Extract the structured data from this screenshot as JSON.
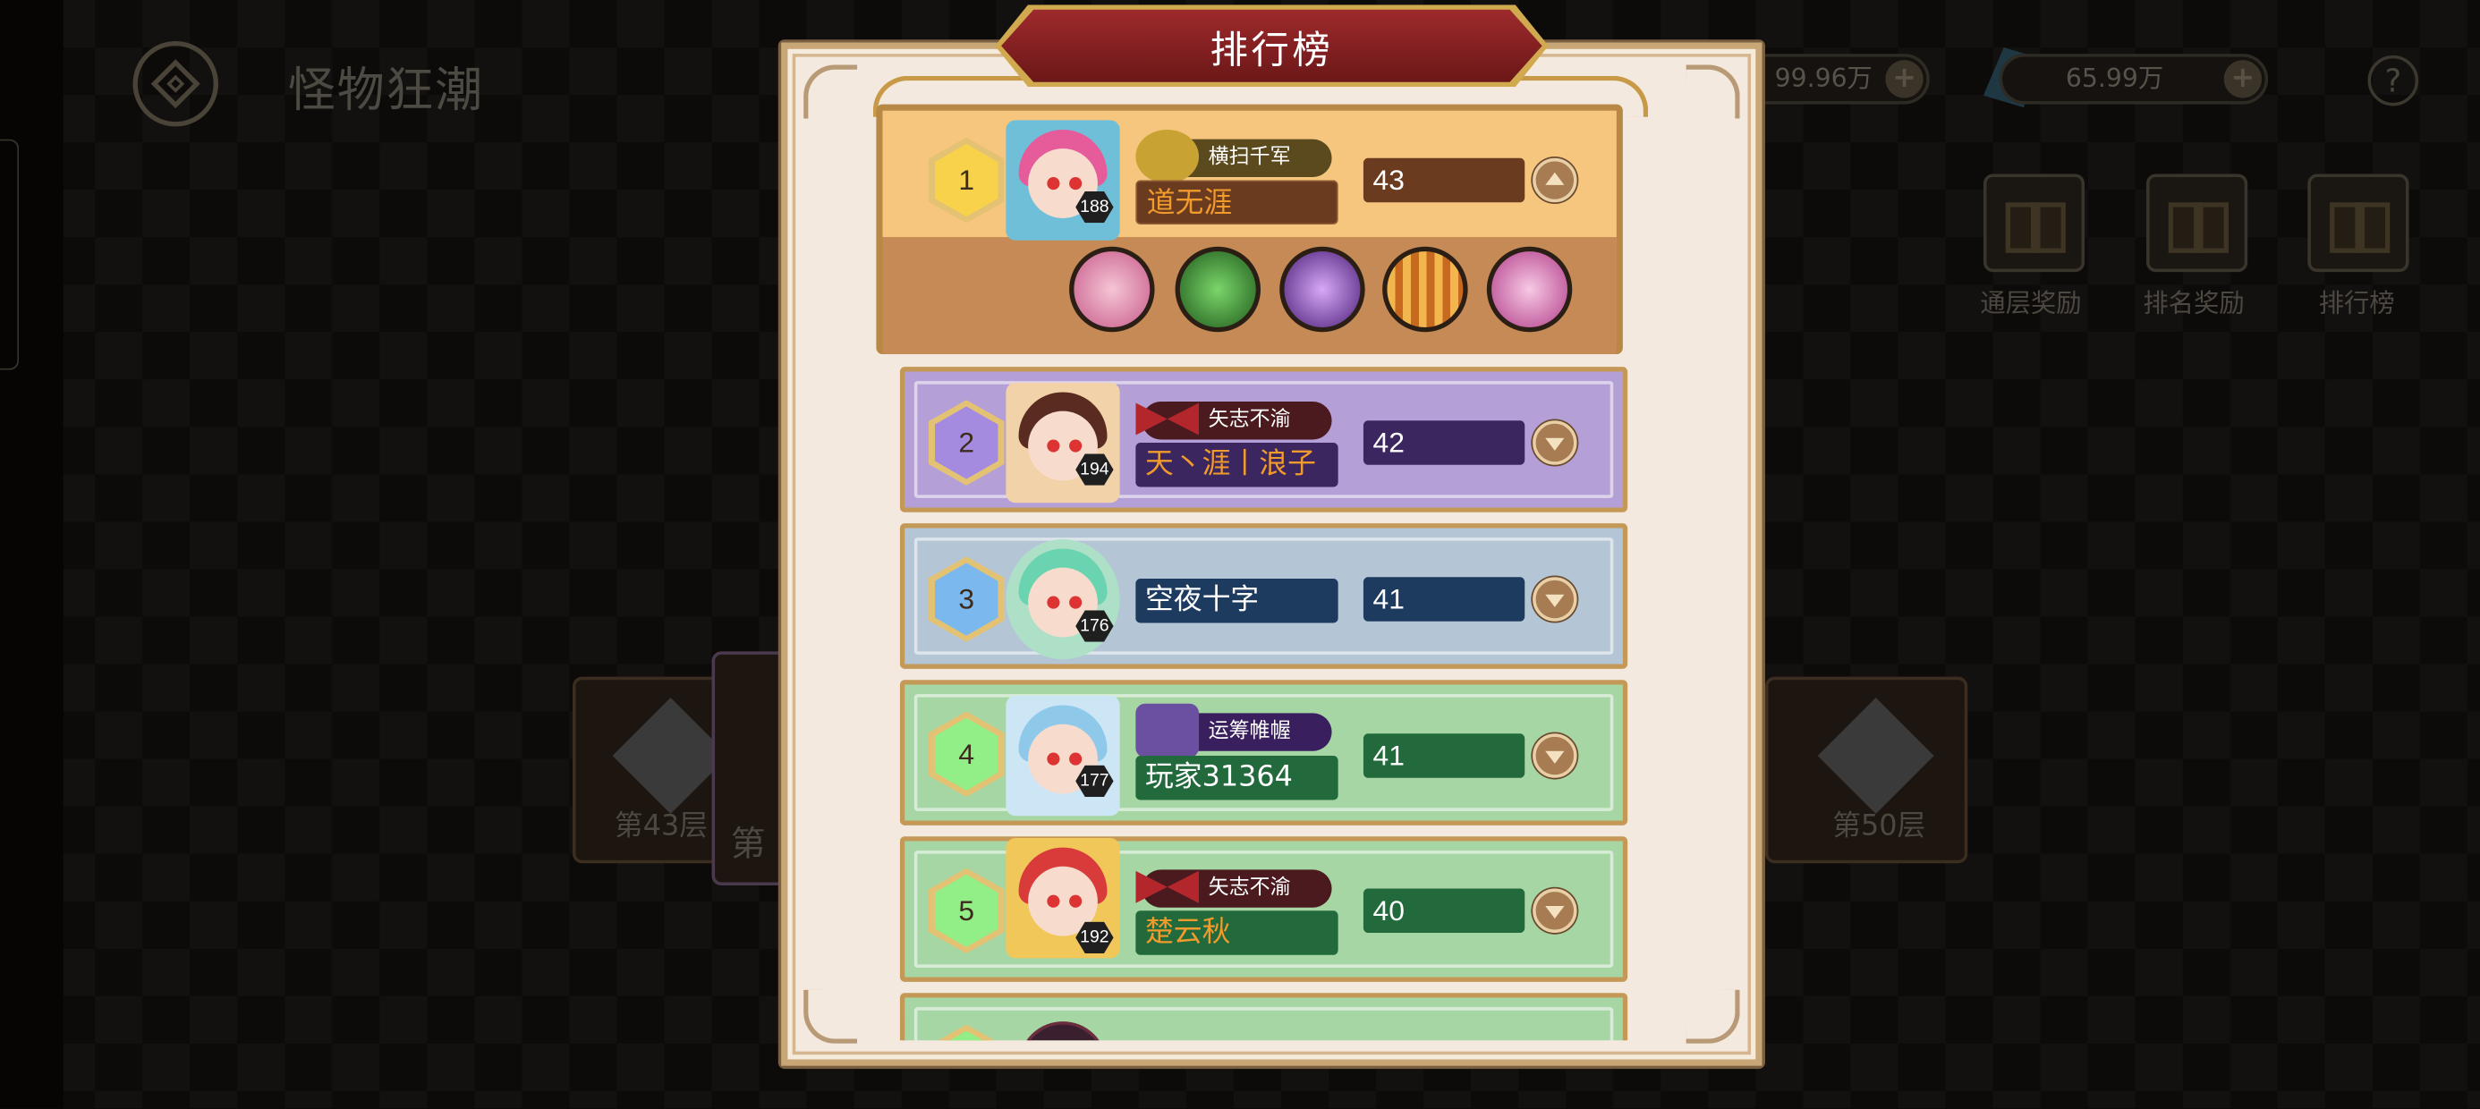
{
  "top_bar": {
    "title": "怪物狂潮",
    "currency1_value": "99.96万",
    "currency2_value": "65.99万",
    "plus": "+",
    "help": "?"
  },
  "rewards": [
    {
      "label": "通层奖励"
    },
    {
      "label": "排名奖励"
    },
    {
      "label": "排行榜"
    }
  ],
  "floors": {
    "left": "第43层",
    "center": "第",
    "right": "第50层"
  },
  "leaderboard": {
    "title": "排行榜",
    "rows": [
      {
        "rank": "1",
        "level": "188",
        "title": "横扫千军",
        "name": "道无涯",
        "score": "43",
        "expanded": true
      },
      {
        "rank": "2",
        "level": "194",
        "title": "矢志不渝",
        "name": "天丶涯丨浪子",
        "score": "42",
        "expanded": false
      },
      {
        "rank": "3",
        "level": "176",
        "title": "",
        "name": "空夜十字",
        "score": "41",
        "expanded": false
      },
      {
        "rank": "4",
        "level": "177",
        "title": "运筹帷幄",
        "name": "玩家31364",
        "score": "41",
        "expanded": false
      },
      {
        "rank": "5",
        "level": "192",
        "title": "矢志不渝",
        "name": "楚云秋",
        "score": "40",
        "expanded": false
      }
    ],
    "row1_skills": [
      "character-portrait-icon",
      "refresh-icon",
      "shield-emblem-icon",
      "chain-icon",
      "ghost-icon"
    ]
  },
  "colors": {
    "rank1": "#f6c57e",
    "rank2": "#b49fd6",
    "rank3": "#b4c6d6",
    "rank4": "#a7d6a5",
    "rank5": "#a7d6a5",
    "name_orange": "#f19b2c",
    "name_white": "#ffffff"
  }
}
